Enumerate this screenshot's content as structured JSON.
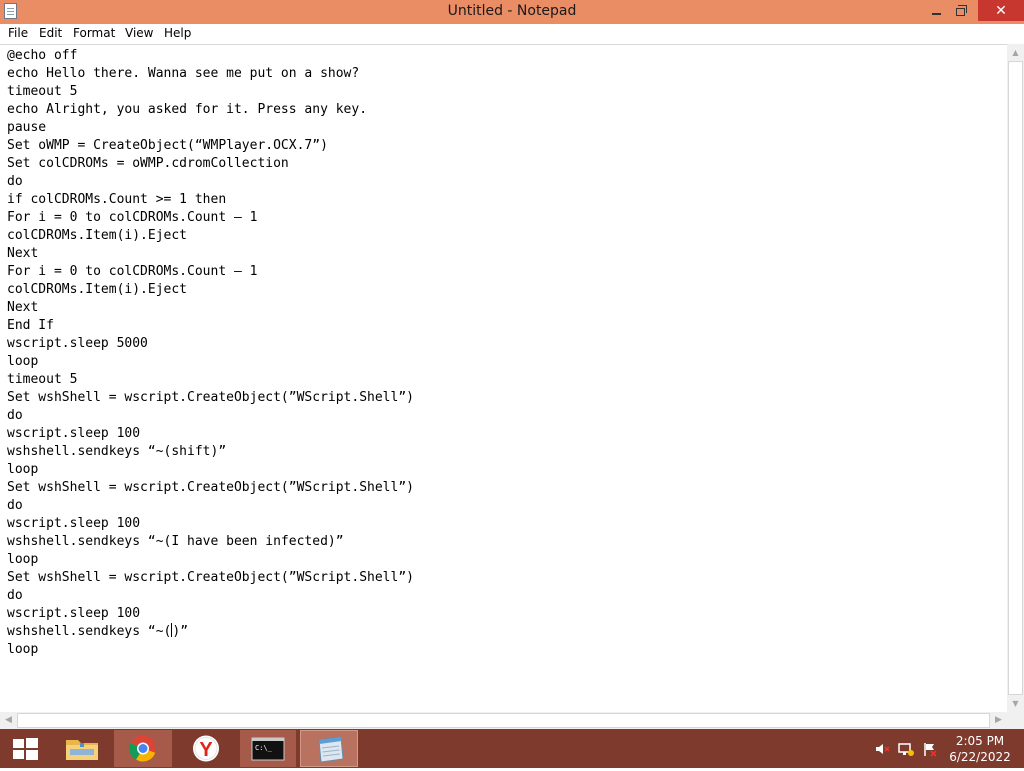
{
  "window": {
    "title": "Untitled - Notepad",
    "close_glyph": "✕"
  },
  "menu": [
    "File",
    "Edit",
    "Format",
    "View",
    "Help"
  ],
  "editor": {
    "lines_before_cursor": [
      "@echo off",
      "echo Hello there. Wanna see me put on a show?",
      "timeout 5",
      "echo Alright, you asked for it. Press any key.",
      "pause",
      "Set oWMP = CreateObject(“WMPlayer.OCX.7”)",
      "Set colCDROMs = oWMP.cdromCollection",
      "do",
      "if colCDROMs.Count >= 1 then",
      "For i = 0 to colCDROMs.Count – 1",
      "colCDROMs.Item(i).Eject",
      "Next",
      "For i = 0 to colCDROMs.Count – 1",
      "colCDROMs.Item(i).Eject",
      "Next",
      "End If",
      "wscript.sleep 5000",
      "loop",
      "timeout 5",
      "Set wshShell = wscript.CreateObject(”WScript.Shell”)",
      "do",
      "wscript.sleep 100",
      "wshshell.sendkeys “~(shift)”",
      "loop",
      "Set wshShell = wscript.CreateObject(”WScript.Shell”)",
      "do",
      "wscript.sleep 100",
      "wshshell.sendkeys “~(I have been infected)”",
      "loop",
      "Set wshShell = wscript.CreateObject(”WScript.Shell”)",
      "do",
      "wscript.sleep 100",
      "wshshell.sendkeys “~("
    ],
    "text_after_cursor": ")”\nloop"
  },
  "taskbar": {
    "apps": [
      "start-icon",
      "file-explorer-icon",
      "chrome-icon",
      "yandex-browser-icon",
      "command-prompt-icon",
      "notepad-icon"
    ],
    "cmd_text": "C:\\_",
    "yandex_letter": "Y",
    "clock_time": "2:05 PM",
    "clock_date": "6/22/2022"
  },
  "colors": {
    "titlebar": "#EA8C64",
    "close_button": "#C7372F",
    "taskbar": "#7E3B2D"
  }
}
